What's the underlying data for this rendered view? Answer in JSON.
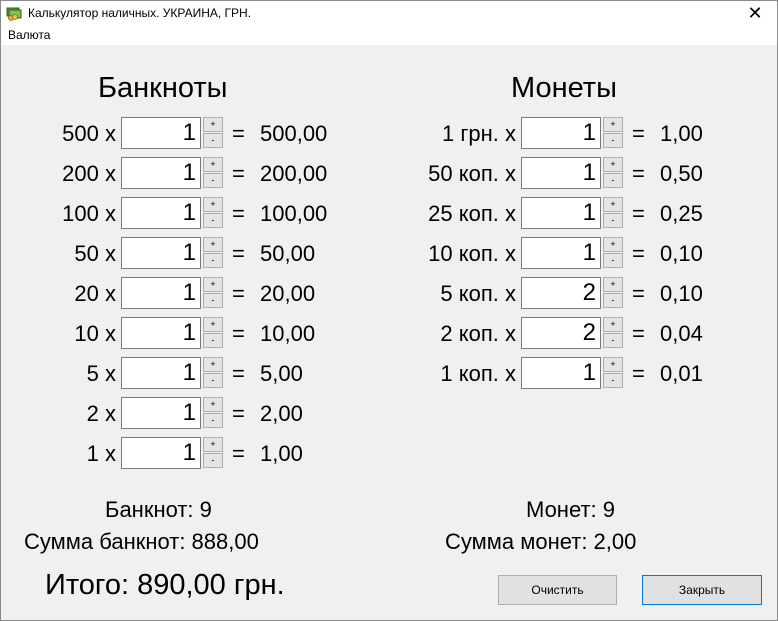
{
  "window": {
    "title": "Калькулятор наличных. УКРАИНА, ГРН.",
    "close_glyph": "✕",
    "app_icon": "cash-calculator-icon"
  },
  "menu": {
    "items": [
      "Валюта"
    ]
  },
  "banknotes": {
    "title": "Банкноты",
    "rows": [
      {
        "label": "500 x",
        "qty": "1",
        "result": "500,00"
      },
      {
        "label": "200 x",
        "qty": "1",
        "result": "200,00"
      },
      {
        "label": "100 x",
        "qty": "1",
        "result": "100,00"
      },
      {
        "label": "50 x",
        "qty": "1",
        "result": "50,00"
      },
      {
        "label": "20 x",
        "qty": "1",
        "result": "20,00"
      },
      {
        "label": "10 x",
        "qty": "1",
        "result": "10,00"
      },
      {
        "label": "5 x",
        "qty": "1",
        "result": "5,00"
      },
      {
        "label": "2 x",
        "qty": "1",
        "result": "2,00"
      },
      {
        "label": "1 x",
        "qty": "1",
        "result": "1,00"
      }
    ],
    "count_line": "Банкнот: 9",
    "sum_line": "Сумма банкнот:  888,00"
  },
  "coins": {
    "title": "Монеты",
    "rows": [
      {
        "label": "1 грн. x",
        "qty": "1",
        "result": "1,00"
      },
      {
        "label": "50 коп. x",
        "qty": "1",
        "result": "0,50"
      },
      {
        "label": "25 коп. x",
        "qty": "1",
        "result": "0,25"
      },
      {
        "label": "10 коп. x",
        "qty": "1",
        "result": "0,10"
      },
      {
        "label": "5 коп. x",
        "qty": "2",
        "result": "0,10"
      },
      {
        "label": "2 коп. x",
        "qty": "2",
        "result": "0,04"
      },
      {
        "label": "1 коп. x",
        "qty": "1",
        "result": "0,01"
      }
    ],
    "count_line": "Монет: 9",
    "sum_line": "Сумма монет:  2,00"
  },
  "spinner": {
    "up": "+",
    "down": "-",
    "eq": "="
  },
  "total": "Итого:  890,00 грн.",
  "buttons": {
    "clear": "Очистить",
    "close": "Закрыть"
  },
  "colors": {
    "background": "#f0f0f0",
    "button_focus_border": "#0078d7"
  }
}
